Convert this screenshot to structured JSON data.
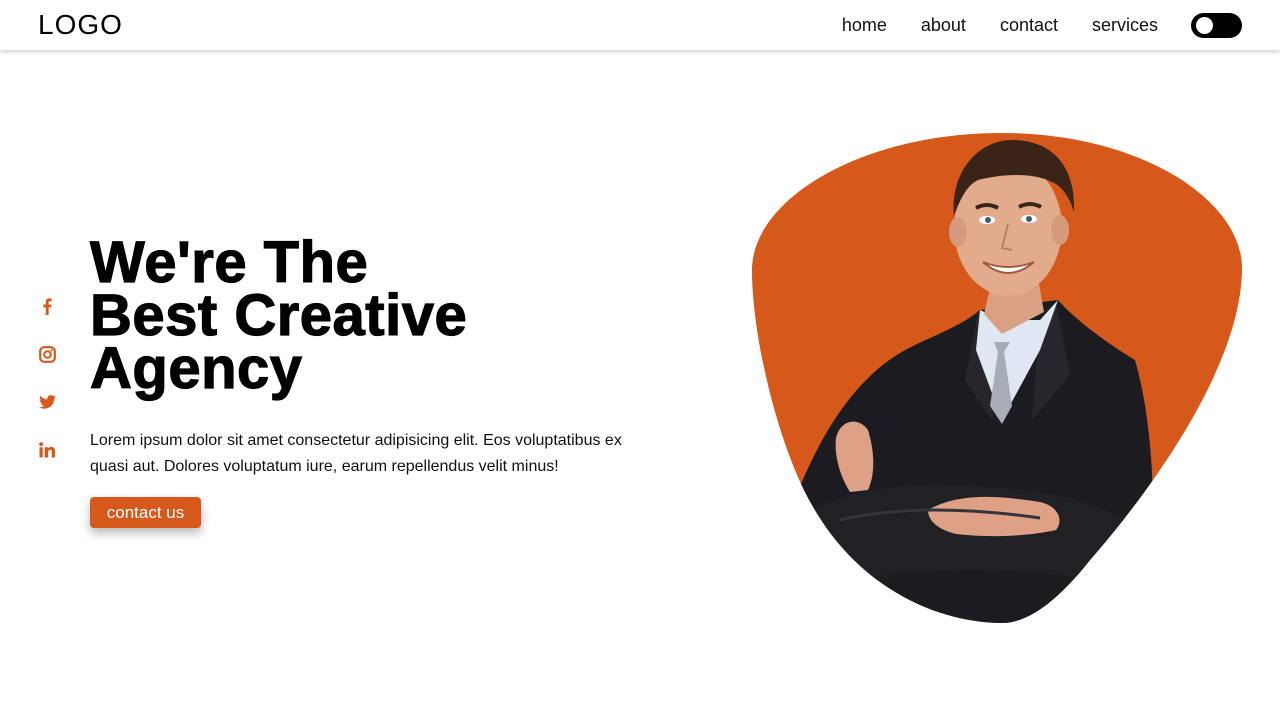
{
  "header": {
    "logo": "LOGO",
    "nav": [
      {
        "label": "home"
      },
      {
        "label": "about"
      },
      {
        "label": "contact"
      },
      {
        "label": "services"
      }
    ]
  },
  "social": {
    "icons": [
      "facebook-icon",
      "instagram-icon",
      "twitter-icon",
      "linkedin-icon"
    ]
  },
  "hero": {
    "title_lines": [
      "We're The",
      "Best Creative",
      "Agency"
    ],
    "description": "Lorem ipsum dolor sit amet consectetur adipisicing elit. Eos voluptatibus ex quasi aut. Dolores voluptatum iure, earum repellendus velit minus!",
    "cta_label": "contact us",
    "image_subject": "smiling man in dark suit with crossed arms"
  },
  "colors": {
    "accent": "#d6581a",
    "text": "#000000",
    "background": "#ffffff"
  }
}
